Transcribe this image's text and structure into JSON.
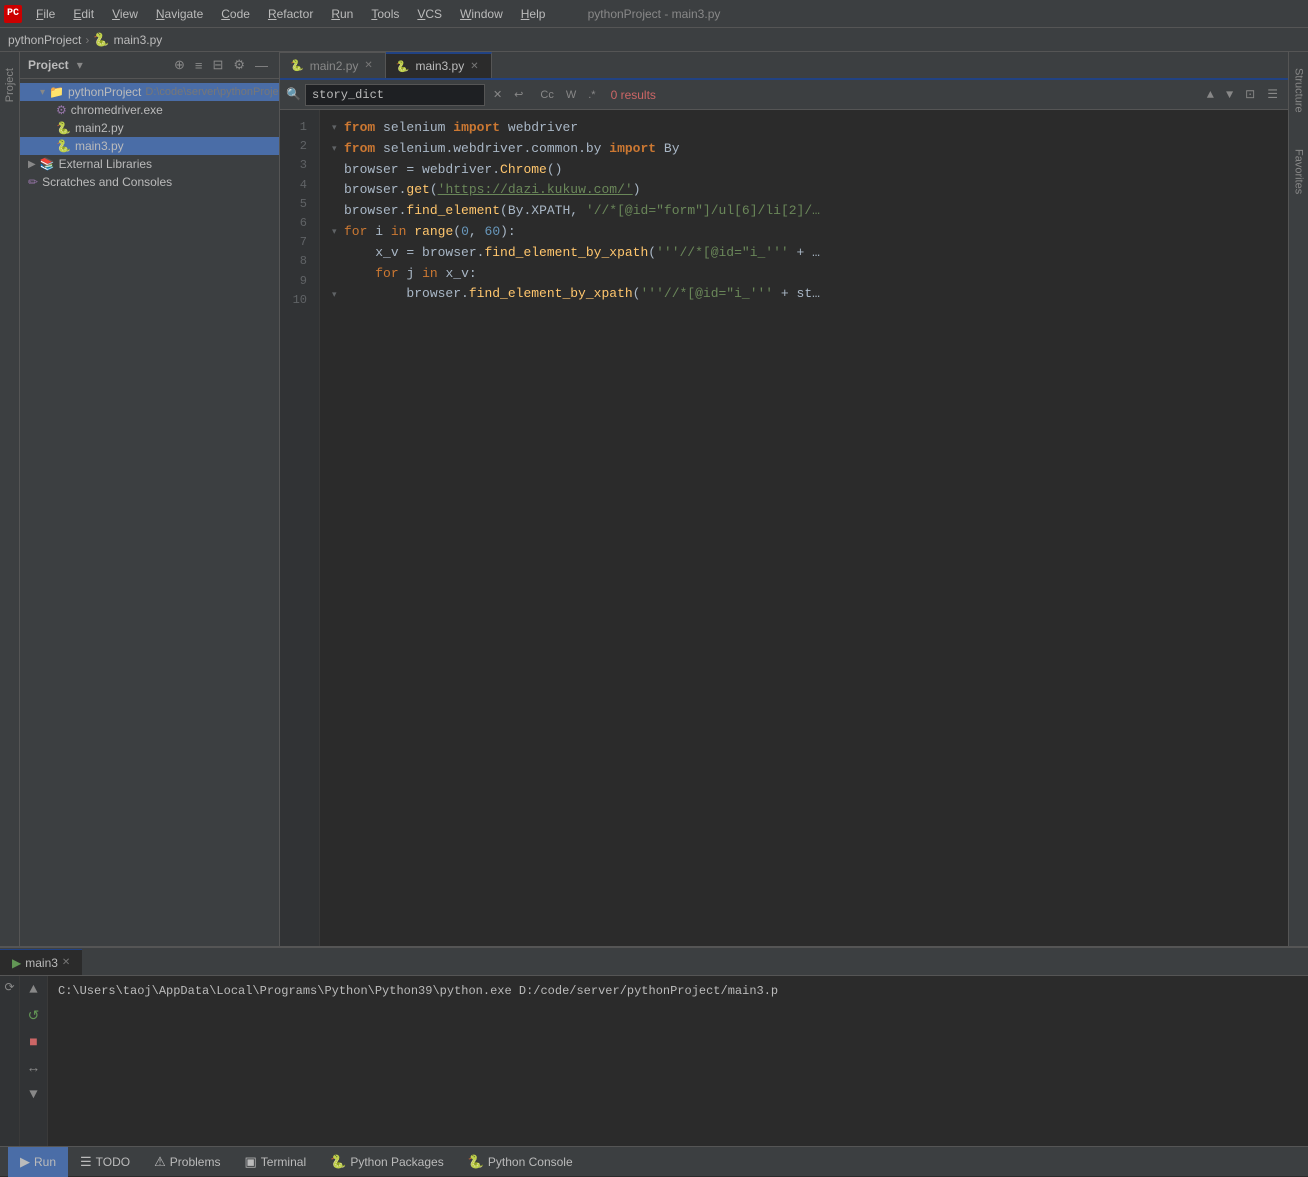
{
  "app": {
    "title": "pythonProject - main3.py",
    "logo": "PC"
  },
  "menu": {
    "items": [
      "File",
      "Edit",
      "View",
      "Navigate",
      "Code",
      "Refactor",
      "Run",
      "Tools",
      "VCS",
      "Window",
      "Help"
    ]
  },
  "breadcrumb": {
    "project": "pythonProject",
    "file": "main3.py"
  },
  "project": {
    "header": "Project",
    "root": "pythonProject",
    "root_path": "D:\\code\\server\\pythonProject",
    "items": [
      {
        "name": "pythonProject",
        "type": "folder",
        "indent": 0,
        "expanded": true
      },
      {
        "name": "chromedriver.exe",
        "type": "exe",
        "indent": 1
      },
      {
        "name": "main2.py",
        "type": "py",
        "indent": 1
      },
      {
        "name": "main3.py",
        "type": "py",
        "indent": 1
      },
      {
        "name": "External Libraries",
        "type": "folder",
        "indent": 0,
        "expanded": false
      },
      {
        "name": "Scratches and Consoles",
        "type": "folder",
        "indent": 0,
        "expanded": false
      }
    ]
  },
  "tabs": {
    "items": [
      {
        "name": "main2.py",
        "active": false,
        "icon": "🐍"
      },
      {
        "name": "main3.py",
        "active": true,
        "icon": "🐍"
      }
    ]
  },
  "search": {
    "query": "story_dict",
    "placeholder": "story_dict",
    "results": "0 results",
    "options": [
      "Cc",
      "W",
      ".*"
    ]
  },
  "code": {
    "lines": [
      {
        "num": 1,
        "fold": true,
        "content": "from_selenium_import_webdriver"
      },
      {
        "num": 2,
        "fold": true,
        "content": "from_selenium.webdriver.common.by_import_By"
      },
      {
        "num": 3,
        "fold": false,
        "content": "browser_=_webdriver.Chrome()"
      },
      {
        "num": 4,
        "fold": false,
        "content": "browser.get_url"
      },
      {
        "num": 5,
        "fold": false,
        "content": "browser.find_element_xpath5"
      },
      {
        "num": 6,
        "fold": true,
        "content": "for_i_in_range_0_60"
      },
      {
        "num": 7,
        "fold": false,
        "content": "x_v_find_by_xpath"
      },
      {
        "num": 8,
        "fold": false,
        "content": "for_j_in_x_v"
      },
      {
        "num": 9,
        "fold": false,
        "content": "browser_find_element_by_xpath9"
      },
      {
        "num": 10,
        "fold": false,
        "content": ""
      }
    ]
  },
  "run": {
    "tab_label": "main3",
    "command": "C:\\Users\\taoj\\AppData\\Local\\Programs\\Python\\Python39\\python.exe D:/code/server/pythonProject/main3.p"
  },
  "statusbar": {
    "run_label": "Run",
    "todo_label": "TODO",
    "problems_label": "Problems",
    "terminal_label": "Terminal",
    "python_packages_label": "Python Packages",
    "python_console_label": "Python Console"
  },
  "sidebar_left": {
    "structure_label": "Structure",
    "favorites_label": "Favorites"
  },
  "colors": {
    "accent": "#214283",
    "bg_dark": "#2b2b2b",
    "bg_panel": "#3c3f41",
    "text_main": "#a9b7c6",
    "keyword": "#cc7832",
    "string": "#6a8759",
    "number": "#6897bb",
    "function": "#ffc66d",
    "comment": "#808080"
  }
}
